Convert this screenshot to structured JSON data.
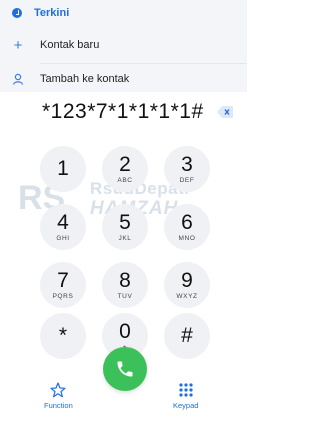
{
  "recents": {
    "label": "Terkini"
  },
  "menu": {
    "new_contact": "Kontak baru",
    "add_to_contact": "Tambah ke kontak"
  },
  "dialer": {
    "number": "*123*7*1*1*1*1#"
  },
  "keys": [
    {
      "digit": "1",
      "letters": ""
    },
    {
      "digit": "2",
      "letters": "ABC"
    },
    {
      "digit": "3",
      "letters": "DEF"
    },
    {
      "digit": "4",
      "letters": "GHI"
    },
    {
      "digit": "5",
      "letters": "JKL"
    },
    {
      "digit": "6",
      "letters": "MNO"
    },
    {
      "digit": "7",
      "letters": "PQRS"
    },
    {
      "digit": "8",
      "letters": "TUV"
    },
    {
      "digit": "9",
      "letters": "WXYZ"
    },
    {
      "digit": "*",
      "letters": ""
    },
    {
      "digit": "0",
      "letters": "+"
    },
    {
      "digit": "#",
      "letters": ""
    }
  ],
  "bottom": {
    "function_label": "Function",
    "keypad_label": "Keypad"
  },
  "watermark": {
    "line1": "RsudDepati",
    "line2": "HAMZAH",
    "mark": "RS"
  },
  "colors": {
    "accent": "#1e6fe3",
    "call": "#3cc15a",
    "key_bg": "#f0f1f4"
  },
  "icons": [
    "recent-icon",
    "plus-icon",
    "person-icon",
    "backspace-icon",
    "star-icon",
    "phone-icon",
    "keypad-grid-icon"
  ]
}
